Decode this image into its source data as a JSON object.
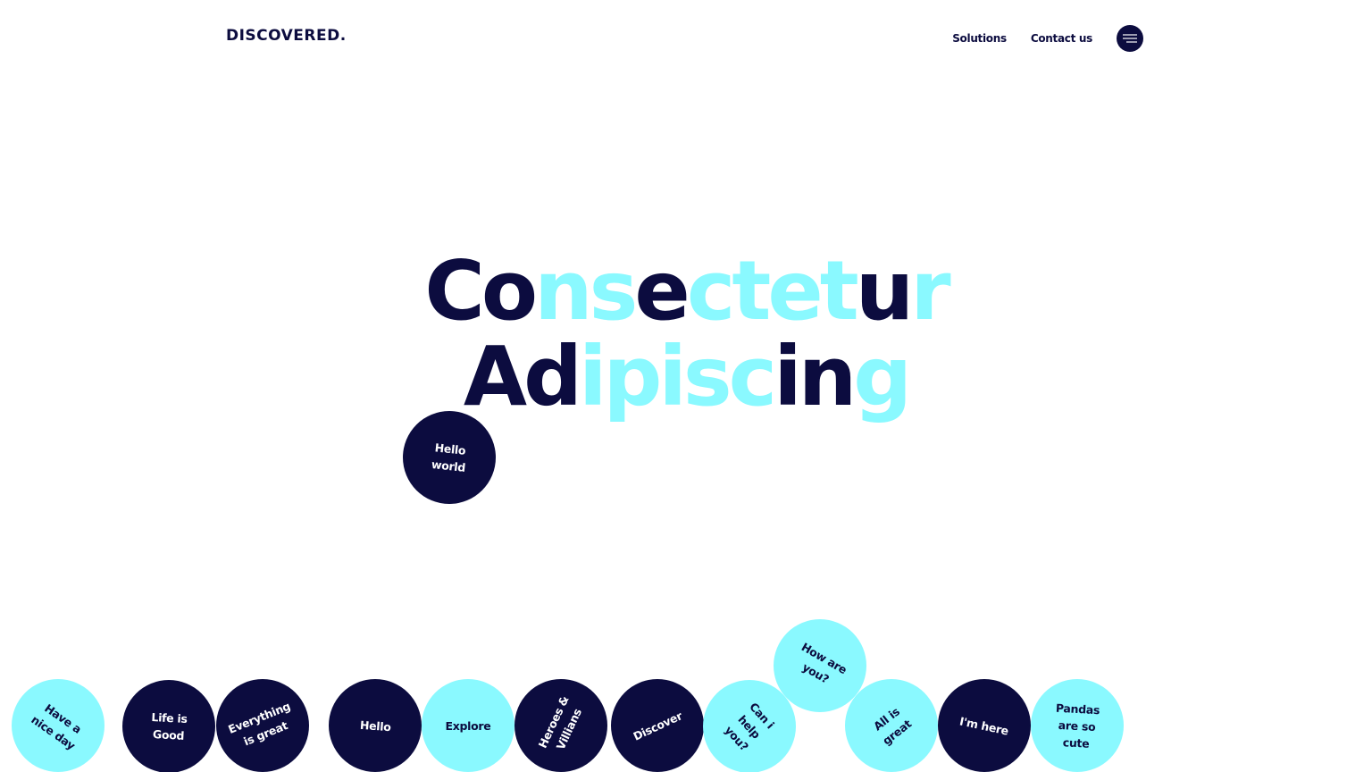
{
  "brand": {
    "logo": "DISCOVERED.",
    "dark": "#0c0c3f",
    "accent": "#8af9ff"
  },
  "nav": {
    "items": [
      {
        "label": "Solutions"
      },
      {
        "label": "Contact us"
      }
    ],
    "menu_icon": "hamburger-menu-icon"
  },
  "hero": {
    "line1": "Consectetur",
    "line2": "Adipiscing"
  },
  "bubbles": [
    {
      "label": "Hello\nworld",
      "style": "dark"
    },
    {
      "label": "Have a\nnice day",
      "style": "light"
    },
    {
      "label": "Life is\nGood",
      "style": "dark"
    },
    {
      "label": "Everything\nis great",
      "style": "dark"
    },
    {
      "label": "Hello",
      "style": "dark"
    },
    {
      "label": "Explore",
      "style": "light"
    },
    {
      "label": "Heroes &\nVillians",
      "style": "dark"
    },
    {
      "label": "Discover",
      "style": "dark"
    },
    {
      "label": "Can i\nhelp\nyou?",
      "style": "light"
    },
    {
      "label": "How are\nyou?",
      "style": "light"
    },
    {
      "label": "All is\ngreat",
      "style": "light"
    },
    {
      "label": "I'm here",
      "style": "dark"
    },
    {
      "label": "Pandas\nare so\ncute",
      "style": "light"
    }
  ]
}
